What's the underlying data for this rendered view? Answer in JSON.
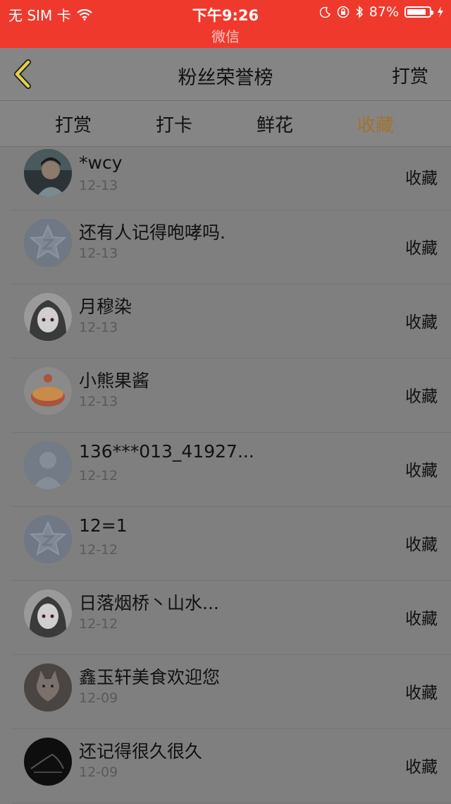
{
  "status_bar": {
    "carrier": "无 SIM 卡",
    "time": "下午9:26",
    "app": "微信",
    "battery": "87%",
    "battery_level": 0.87
  },
  "nav": {
    "title": "粉丝荣誉榜",
    "right_label": "打赏"
  },
  "tabs": [
    {
      "label": "打赏",
      "active": false
    },
    {
      "label": "打卡",
      "active": false
    },
    {
      "label": "鲜花",
      "active": false
    },
    {
      "label": "收藏",
      "active": true
    }
  ],
  "colors": {
    "status_bar": "#f0392d",
    "active_tab": "#a4722c"
  },
  "fans": [
    {
      "name": "*wcy",
      "date": "12-13",
      "action": "收藏",
      "avatar": "photo-avatar"
    },
    {
      "name": "还有人记得咆哮吗.",
      "date": "12-13",
      "action": "收藏",
      "avatar": "default-star-avatar"
    },
    {
      "name": "月穆染",
      "date": "12-13",
      "action": "收藏",
      "avatar": "anime-avatar"
    },
    {
      "name": "小熊果酱",
      "date": "12-13",
      "action": "收藏",
      "avatar": "food-avatar"
    },
    {
      "name": "136***013_41927...",
      "date": "12-12",
      "action": "收藏",
      "avatar": "default-person-avatar"
    },
    {
      "name": "12=1",
      "date": "12-12",
      "action": "收藏",
      "avatar": "default-star-avatar"
    },
    {
      "name": "日落烟桥丶山水...",
      "date": "12-12",
      "action": "收藏",
      "avatar": "anime-avatar"
    },
    {
      "name": "鑫玉轩美食欢迎您",
      "date": "12-09",
      "action": "收藏",
      "avatar": "cat-avatar"
    },
    {
      "name": "还记得很久很久",
      "date": "12-09",
      "action": "收藏",
      "avatar": "dark-photo-avatar"
    }
  ]
}
